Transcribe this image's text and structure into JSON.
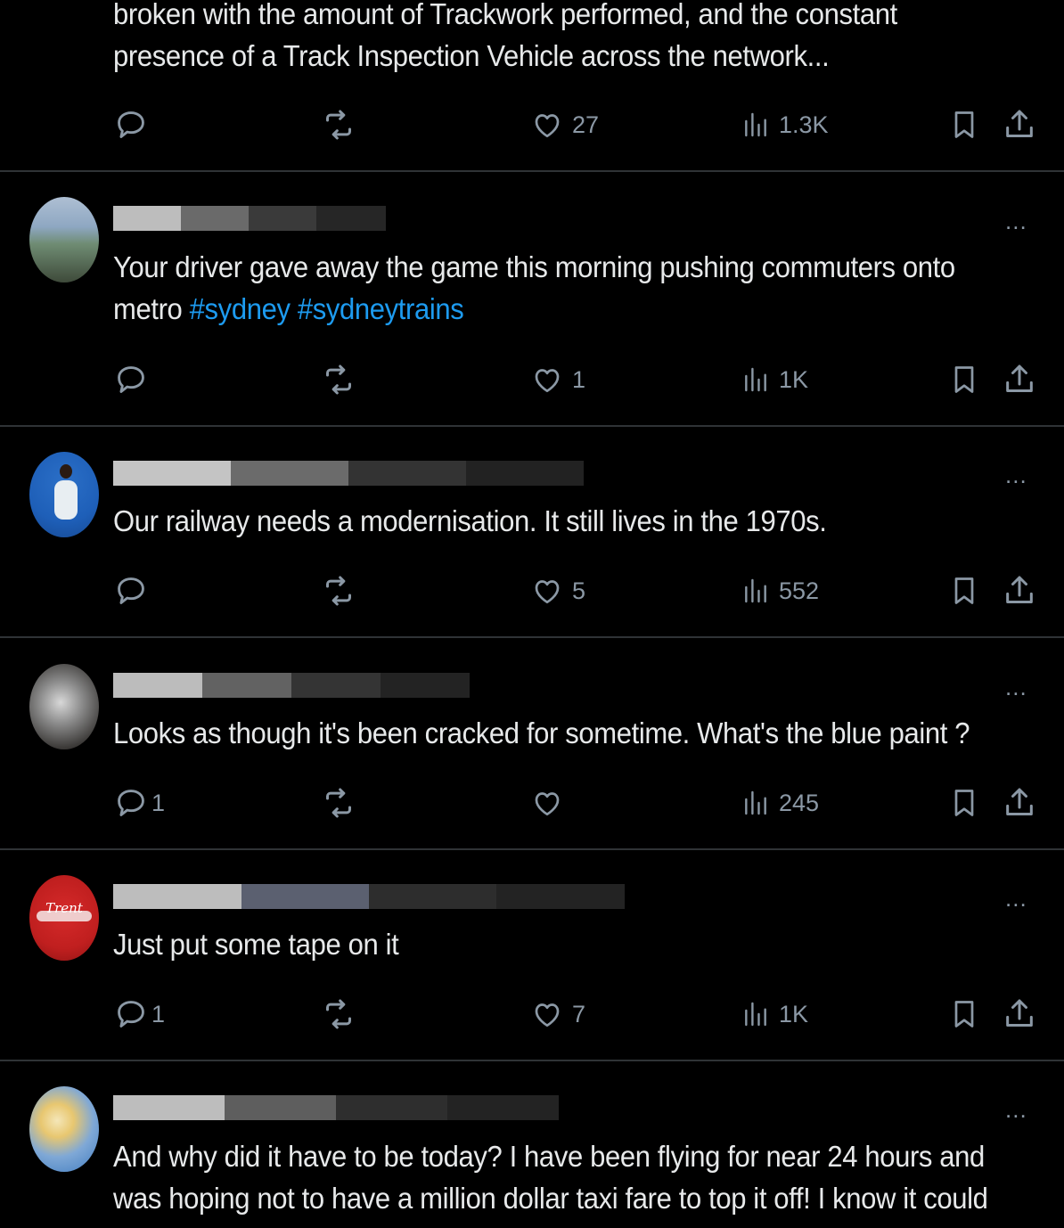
{
  "colors": {
    "background": "#000000",
    "text": "#e7e9ea",
    "muted": "#8b98a5",
    "hashtag": "#1d9bf0",
    "divider": "#2f3336"
  },
  "icons": {
    "reply": "reply-icon",
    "repost": "repost-icon",
    "like": "heart-icon",
    "views": "views-icon",
    "bookmark": "bookmark-icon",
    "share": "share-icon",
    "more": "more-icon"
  },
  "posts": [
    {
      "lines": [
        "broken with the amount of Trackwork performed, and the constant",
        "presence of a Track Inspection Vehicle across the network..."
      ],
      "replies": "",
      "likes": "27",
      "views": "1.3K"
    },
    {
      "lines": [
        "Your driver gave away the game this morning pushing commuters onto"
      ],
      "line2_text": "metro",
      "hashtags": [
        "#sydney",
        "#sydneytrains"
      ],
      "more": "...",
      "replies": "",
      "likes": "1",
      "views": "1K"
    },
    {
      "lines": [
        "Our railway needs a modernisation. It still lives in the 1970s."
      ],
      "more": "...",
      "replies": "",
      "likes": "5",
      "views": "552"
    },
    {
      "lines": [
        "Looks as though it's been cracked for sometime. What's the blue paint ?"
      ],
      "more": "...",
      "replies": "1",
      "likes": "",
      "views": "245"
    },
    {
      "lines": [
        "Just put some tape on it"
      ],
      "more": "...",
      "avatar_text": "Trent",
      "replies": "1",
      "likes": "7",
      "views": "1K"
    },
    {
      "lines": [
        "And why did it have to be today? I have been flying for near 24 hours and",
        "was hoping not to have a million dollar taxi fare to top it off! I know it could"
      ],
      "more": "..."
    }
  ]
}
